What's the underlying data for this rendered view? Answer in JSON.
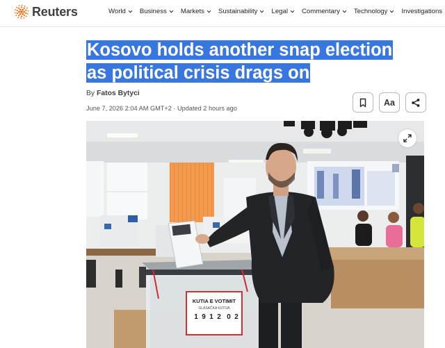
{
  "site": {
    "logo_text": "Reuters",
    "logo_icon": "reuters-dot-logo",
    "brand_color": "#fa6400"
  },
  "nav": {
    "items": [
      {
        "label": "World",
        "has_dropdown": true
      },
      {
        "label": "Business",
        "has_dropdown": true
      },
      {
        "label": "Markets",
        "has_dropdown": true
      },
      {
        "label": "Sustainability",
        "has_dropdown": true
      },
      {
        "label": "Legal",
        "has_dropdown": true
      },
      {
        "label": "Commentary",
        "has_dropdown": true
      },
      {
        "label": "Technology",
        "has_dropdown": true
      },
      {
        "label": "Investigations",
        "has_dropdown": false
      }
    ]
  },
  "article": {
    "headline": "Kosovo holds another snap election as political crisis drags on",
    "headline_selected": true,
    "selection_color": "#3877e0",
    "byline_prefix": "By",
    "author": "Fatos Bytyci",
    "dateline": "June 7, 2026 2:04 AM GMT+2 · Updated 2 hours ago"
  },
  "tools": {
    "bookmark_icon": "bookmark-icon",
    "text_size_label": "Aa",
    "share_icon": "share-icon"
  },
  "photo": {
    "expand_icon": "expand-icon",
    "ballot_box_label": "KUTIA E VOTIMIT",
    "ballot_box_sublabel": "GLASAČKA KUTIJA",
    "ballot_box_number": [
      "1",
      "9",
      "1",
      "2",
      "0",
      "2"
    ]
  }
}
